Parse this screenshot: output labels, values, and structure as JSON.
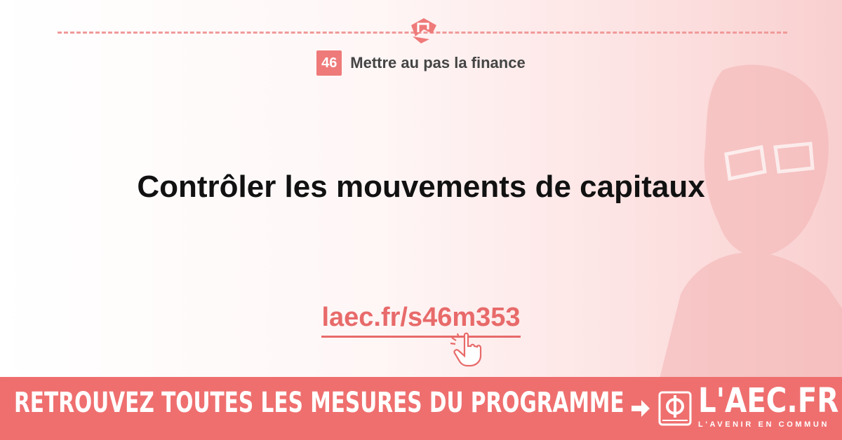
{
  "chapter": {
    "number": "46",
    "title": "Mettre au pas la finance"
  },
  "headline": "Contrôler les mouvements de capitaux",
  "link": {
    "text": "laec.fr/s46m353"
  },
  "banner": {
    "text": "RETROUVEZ TOUTES LES MESURES DU PROGRAMME",
    "logo_text": "L'AEC.FR",
    "logo_subtitle": "L'AVENIR EN COMMUN"
  },
  "icons": {
    "top": "handshake-icon",
    "pointer": "pointer-hand-icon",
    "arrow": "arrow-right-icon",
    "logo": "phi-book-icon"
  },
  "colors": {
    "accent": "#ef6f6f",
    "link": "#e86a6a",
    "dashed_line": "#f09a9a",
    "headline": "#111111"
  }
}
